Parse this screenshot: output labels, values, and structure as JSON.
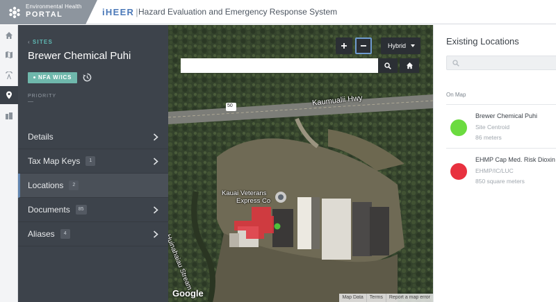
{
  "header": {
    "portal_line1": "Environmental Health",
    "portal_line2": "PORTAL",
    "app_name": "iHEER",
    "app_subtitle": "Hazard Evaluation and Emergency Response System"
  },
  "rail": {
    "items": [
      {
        "icon": "home-icon",
        "active": false
      },
      {
        "icon": "map-icon",
        "active": false
      },
      {
        "icon": "radio-tower-icon",
        "active": false
      },
      {
        "icon": "location-pin-icon",
        "active": true
      },
      {
        "icon": "buildings-icon",
        "active": false
      }
    ]
  },
  "sidebar": {
    "breadcrumb": "SITES",
    "site_title": "Brewer Chemical Puhi",
    "badge": "NFA W/ICS",
    "priority_label": "PRIORITY",
    "nav": [
      {
        "label": "Details",
        "count": null,
        "active": false
      },
      {
        "label": "Tax Map Keys",
        "count": "1",
        "active": false
      },
      {
        "label": "Locations",
        "count": "2",
        "active": true
      },
      {
        "label": "Documents",
        "count": "85",
        "active": false
      },
      {
        "label": "Aliases",
        "count": "4",
        "active": false
      }
    ]
  },
  "map": {
    "maptype": "Hybrid",
    "search_value": "",
    "road_label": "Kaumualii Hwy",
    "route_shield": "50",
    "place_label_1": "Kauai Veterans",
    "place_label_2": "Express Co",
    "stream_label": "Huinahaiau Stream",
    "google": "Google",
    "footer": [
      "Map Data",
      "Terms",
      "Report a map error"
    ]
  },
  "locations_panel": {
    "title": "Existing Locations",
    "search_placeholder": "",
    "section_label": "On Map",
    "items": [
      {
        "name": "Brewer Chemical Puhi",
        "type": "Site Centroid",
        "area": "86 meters",
        "color": "#6bdb3f"
      },
      {
        "name": "EHMP Cap Med. Risk Dioxin",
        "type": "EHMP/IC/LUC",
        "area": "850 square meters",
        "color": "#e8313f"
      }
    ]
  },
  "colors": {
    "accent": "#5fb9b4",
    "sidebar_bg": "#3d434b",
    "active_nav_border": "#5f82ad"
  }
}
